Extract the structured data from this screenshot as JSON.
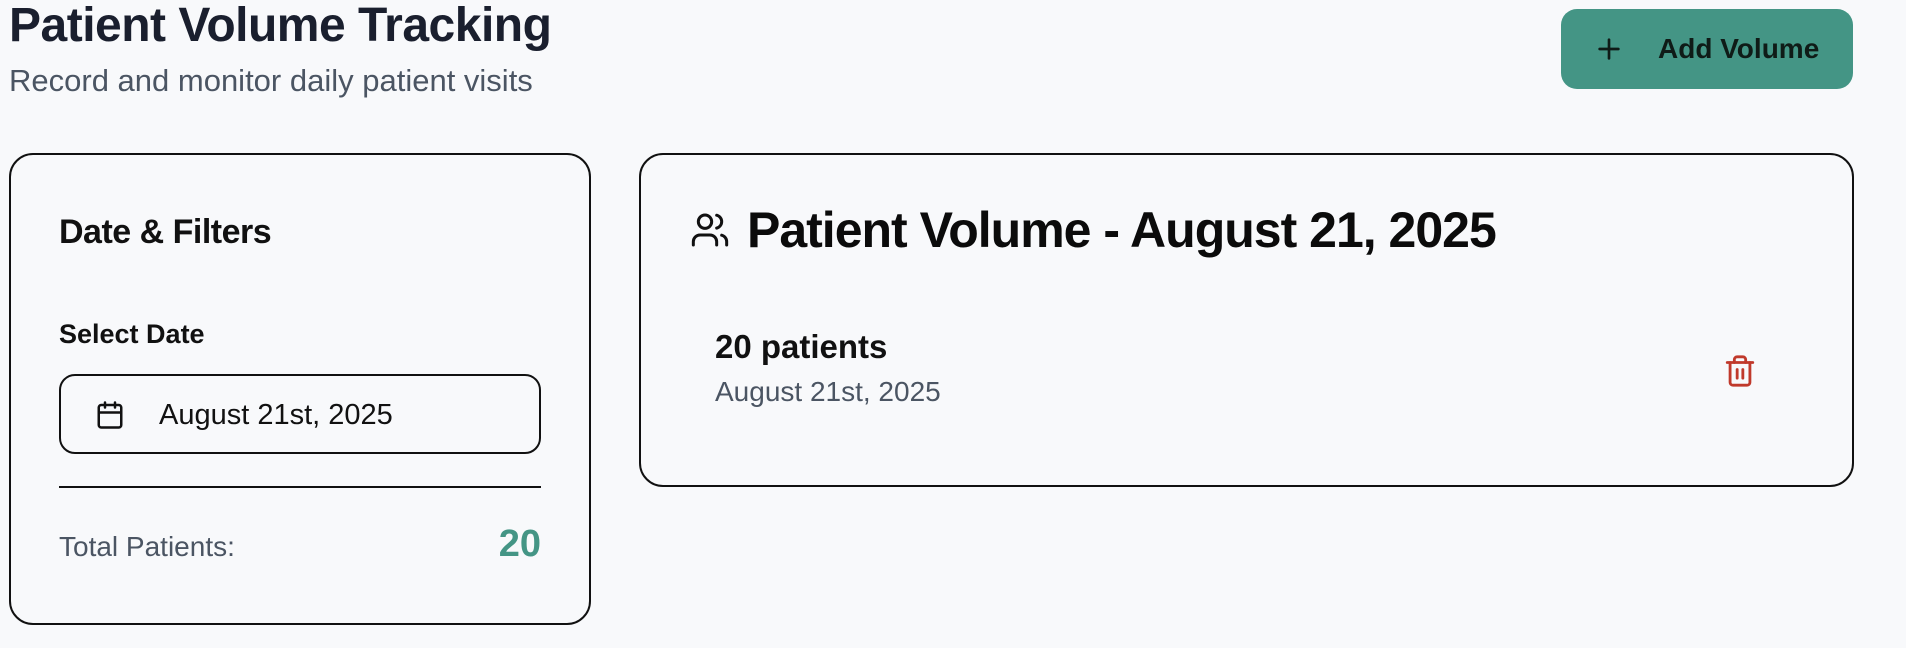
{
  "header": {
    "title": "Patient Volume Tracking",
    "subtitle": "Record and monitor daily patient visits",
    "add_button_label": "Add Volume",
    "add_button_icon": "plus-icon",
    "accent_color": "#449585"
  },
  "filters": {
    "title": "Date & Filters",
    "select_date_label": "Select Date",
    "selected_date": "August 21st, 2025",
    "calendar_icon": "calendar-icon",
    "total_label": "Total Patients:",
    "total_value": "20"
  },
  "volume": {
    "title": "Patient Volume - August 21, 2025",
    "title_icon": "users-icon",
    "entries": [
      {
        "count_label": "20 patients",
        "date_label": "August 21st, 2025",
        "delete_icon": "trash-icon",
        "delete_color": "#c0392b"
      }
    ]
  }
}
